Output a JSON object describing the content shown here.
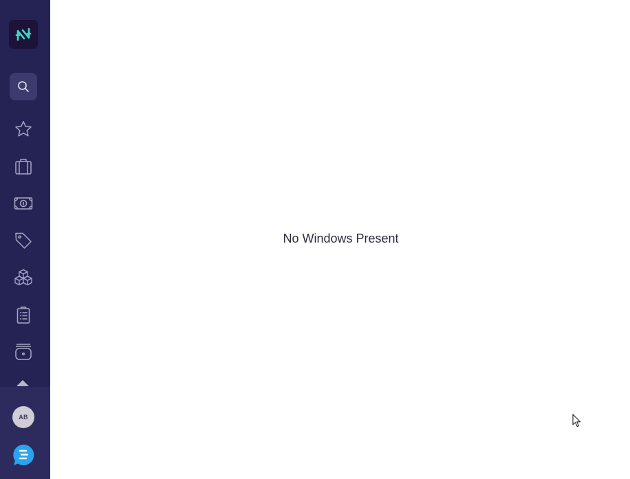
{
  "sidebar": {
    "logo": {
      "icon": "app-logo-icon",
      "color": "#3fd6c2"
    },
    "search": {
      "icon": "search-icon"
    },
    "items": [
      {
        "icon": "star-icon"
      },
      {
        "icon": "briefcase-icon"
      },
      {
        "icon": "money-icon"
      },
      {
        "icon": "tag-icon"
      },
      {
        "icon": "cubes-icon"
      },
      {
        "icon": "clipboard-list-icon"
      },
      {
        "icon": "archive-icon"
      }
    ],
    "scroll_up": {
      "icon": "chevron-up-icon"
    },
    "user": {
      "initials": "AB"
    },
    "chat": {
      "icon": "chat-icon",
      "color": "#2aa4ef"
    }
  },
  "main": {
    "empty_message": "No Windows Present"
  },
  "colors": {
    "sidebar_bg": "#252354",
    "sidebar_icon": "#a9a7c4",
    "accent": "#3fd6c2"
  }
}
